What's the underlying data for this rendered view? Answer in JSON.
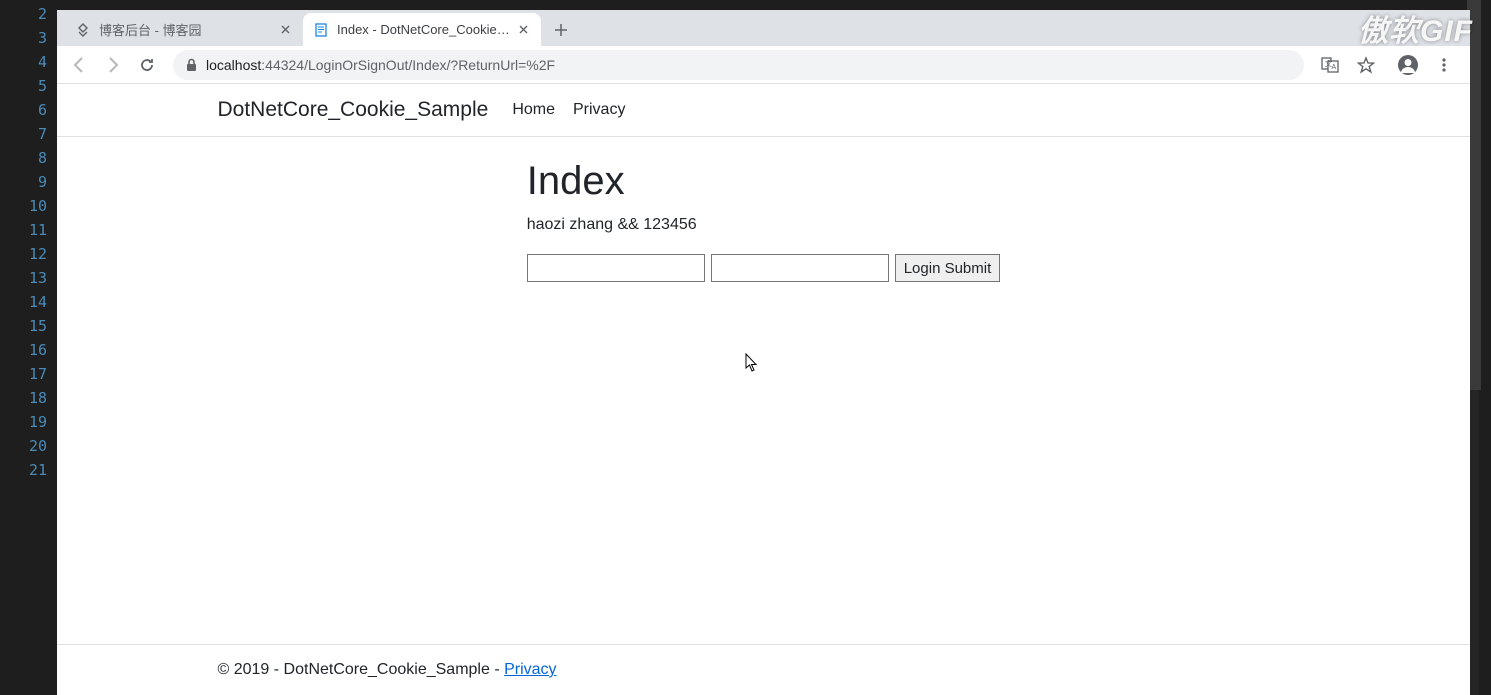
{
  "editor": {
    "line_numbers": [
      "2",
      "3",
      "4",
      "5",
      "6",
      "7",
      "8",
      "9",
      "10",
      "11",
      "12",
      "13",
      "14",
      "15",
      "16",
      "17",
      "18",
      "19",
      "20",
      "21"
    ]
  },
  "watermark": "傲软GIF",
  "browser": {
    "tabs": [
      {
        "title": "博客后台 - 博客园",
        "active": false
      },
      {
        "title": "Index - DotNetCore_Cookie_S...",
        "active": true
      }
    ],
    "address": {
      "host": "localhost",
      "port": ":44324",
      "path": "/LoginOrSignOut/Index/?ReturnUrl=%2F"
    }
  },
  "navbar": {
    "brand": "DotNetCore_Cookie_Sample",
    "links": [
      "Home",
      "Privacy"
    ]
  },
  "page": {
    "title": "Index",
    "credentials": "haozi zhang && 123456",
    "submit_label": "Login Submit"
  },
  "footer": {
    "copyright": "© 2019 - DotNetCore_Cookie_Sample - ",
    "privacy_link": "Privacy"
  }
}
